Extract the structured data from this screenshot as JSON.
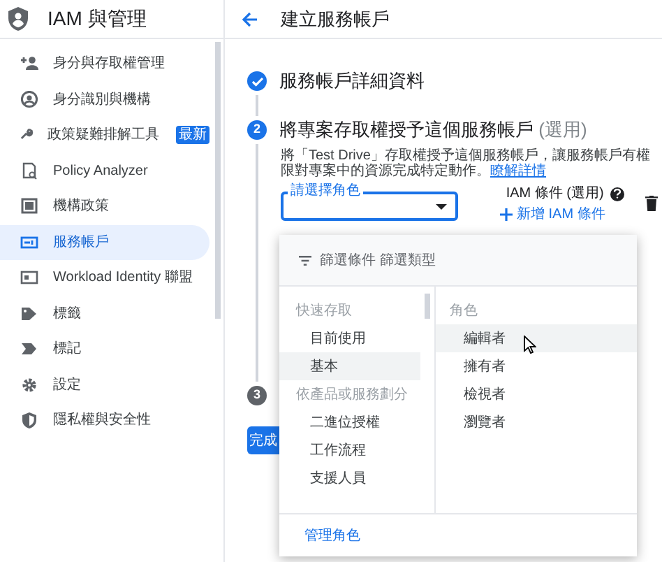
{
  "sidebar": {
    "title": "IAM 與管理",
    "items": [
      {
        "label": "身分與存取權管理",
        "selected": false
      },
      {
        "label": "身分識別與機構",
        "selected": false
      },
      {
        "label": "政策疑難排解工具",
        "badge": "最新",
        "selected": false
      },
      {
        "label": "Policy Analyzer",
        "selected": false
      },
      {
        "label": "機構政策",
        "selected": false
      },
      {
        "label": "服務帳戶",
        "selected": true
      },
      {
        "label": "Workload Identity 聯盟",
        "selected": false
      },
      {
        "label": "標籤",
        "selected": false
      },
      {
        "label": "標記",
        "selected": false
      },
      {
        "label": "設定",
        "selected": false
      },
      {
        "label": "隱私權與安全性",
        "selected": false
      }
    ]
  },
  "header": {
    "title": "建立服務帳戶"
  },
  "steps": [
    {
      "completed": true,
      "title": "服務帳戶詳細資料"
    },
    {
      "completed": false,
      "active": true,
      "number": "2",
      "title": "將專案存取權授予這個服務帳戶",
      "optional": "(選用)",
      "description": "將「Test Drive」存取權授予這個服務帳戶，讓服務帳戶有權限對專案中的資源完成特定動作。",
      "link": "瞭解詳情"
    },
    {
      "completed": false,
      "active": false,
      "number": "3"
    }
  ],
  "role_select": {
    "label": "請選擇角色"
  },
  "iam_condition": {
    "label": "IAM 條件 (選用)",
    "add": "新增 IAM 條件"
  },
  "done_button": "完成",
  "role_menu": {
    "filter": "篩選條件 篩選類型",
    "categories": [
      {
        "kind": "heading",
        "label": "快速存取",
        "selected": false
      },
      {
        "kind": "item",
        "label": "目前使用",
        "selected": false
      },
      {
        "kind": "item",
        "label": "基本",
        "selected": true
      },
      {
        "kind": "heading",
        "label": "依產品或服務劃分",
        "selected": false
      },
      {
        "kind": "item",
        "label": "二進位授權",
        "selected": false
      },
      {
        "kind": "item",
        "label": "工作流程",
        "selected": false
      },
      {
        "kind": "item",
        "label": "支援人員",
        "selected": false
      }
    ],
    "roles_heading": "角色",
    "roles": [
      {
        "label": "編輯者",
        "hovered": true
      },
      {
        "label": "擁有者",
        "hovered": false
      },
      {
        "label": "檢視者",
        "hovered": false
      },
      {
        "label": "瀏覽者",
        "hovered": false
      }
    ],
    "manage": "管理角色"
  }
}
